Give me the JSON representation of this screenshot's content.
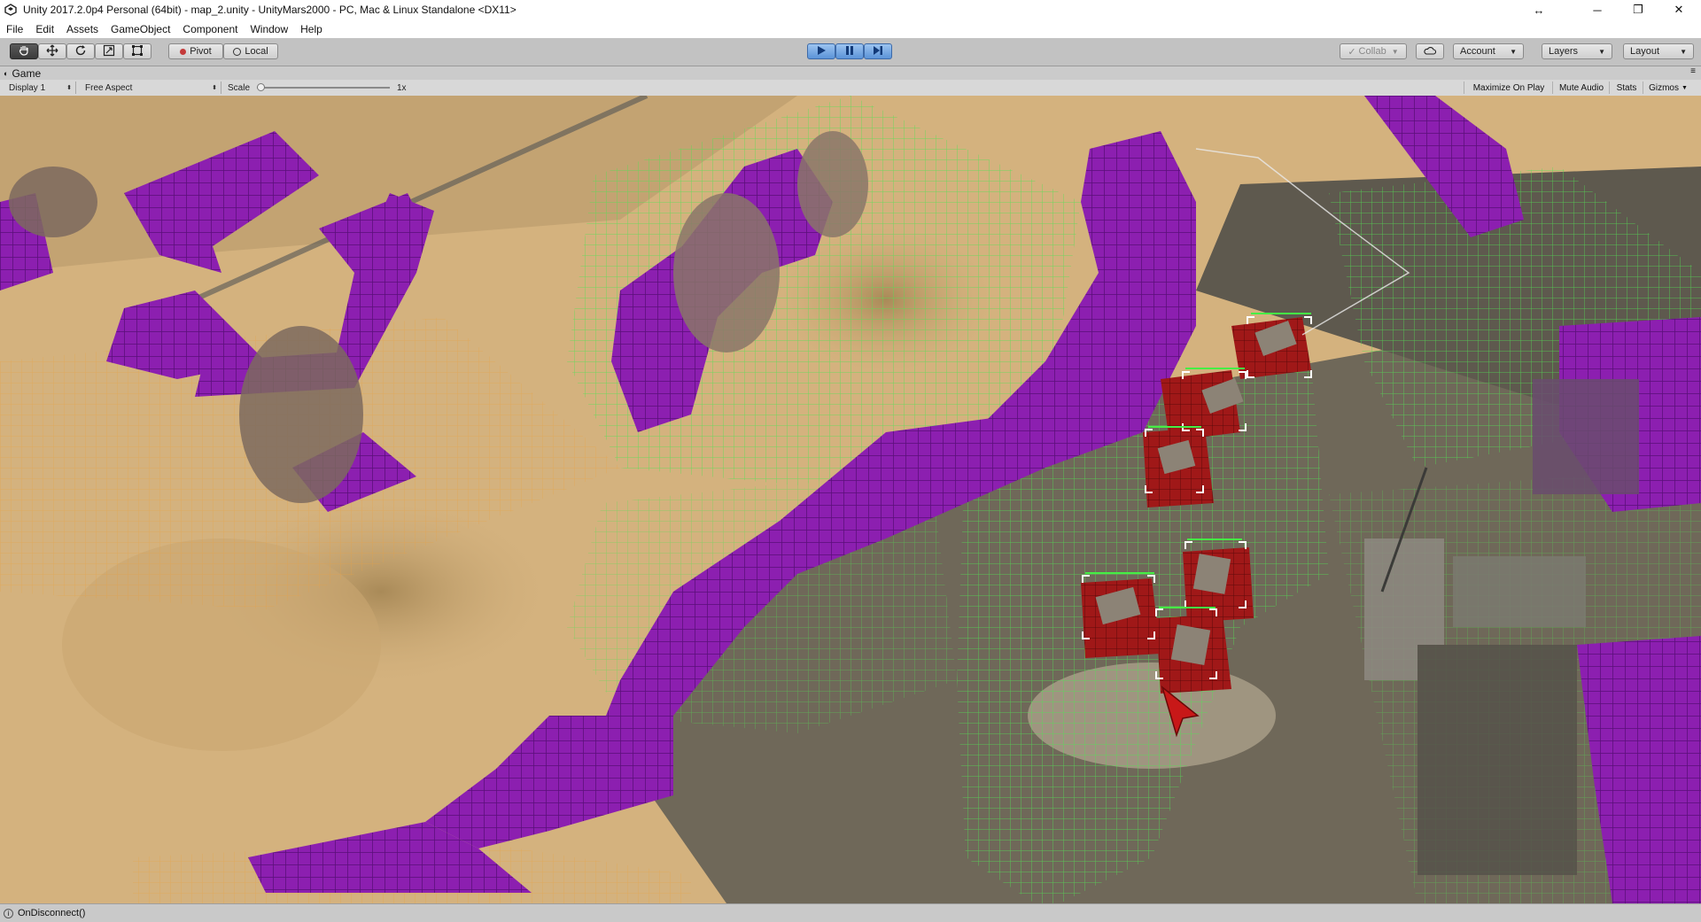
{
  "window": {
    "title": "Unity 2017.2.0p4 Personal (64bit) - map_2.unity - UnityMars2000 - PC, Mac & Linux Standalone <DX11>",
    "controls": {
      "resize": "↔",
      "minimize": "─",
      "restore": "❐",
      "close": "✕"
    }
  },
  "menu": {
    "items": [
      "File",
      "Edit",
      "Assets",
      "GameObject",
      "Component",
      "Window",
      "Help"
    ]
  },
  "toolbar": {
    "tools": [
      "hand-icon",
      "move-icon",
      "rotate-icon",
      "scale-icon",
      "rect-icon"
    ],
    "pivot_label": "Pivot",
    "local_label": "Local",
    "play_state": "playing",
    "collab_label": "Collab",
    "account_label": "Account",
    "layers_label": "Layers",
    "layout_label": "Layout"
  },
  "game_view": {
    "tab_label": "Game",
    "display_label": "Display 1",
    "aspect_label": "Free Aspect",
    "scale_label": "Scale",
    "scale_value": "1x",
    "maximize_label": "Maximize On Play",
    "mute_label": "Mute Audio",
    "stats_label": "Stats",
    "gizmos_label": "Gizmos"
  },
  "status": {
    "message": "OnDisconnect()"
  },
  "colors": {
    "play_accent": "#5b93d8",
    "obstacle_cells": "#8c1fb0",
    "walkable_grid": "#55e055",
    "selected_units": "#a01818",
    "sand": "#d4b27e",
    "ground_dark": "#6f6859"
  }
}
